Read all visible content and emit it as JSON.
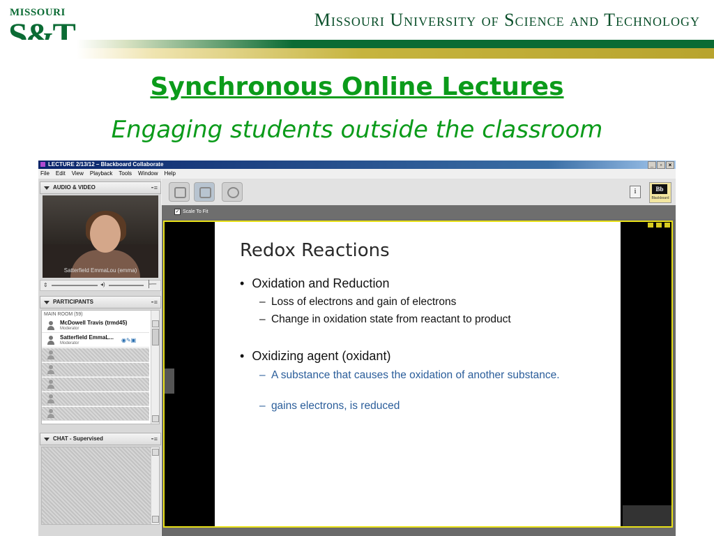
{
  "slide": {
    "logo_top": "MISSOURI",
    "logo_main": "S&T",
    "university": "Missouri University of Science and Technology",
    "title": "Synchronous Online Lectures",
    "subtitle": "Engaging students outside the classroom"
  },
  "colors": {
    "brand_green": "#0b6b34",
    "title_green": "#0b9b1a",
    "gold": "#c6b43e",
    "whiteboard_border": "#e8e018",
    "subpoint_blue": "#2a5d9a"
  },
  "app": {
    "window_title": "LECTURE 2/13/12 – Blackboard Collaborate",
    "window_buttons": [
      "_",
      "▫",
      "×"
    ],
    "menu": [
      "File",
      "Edit",
      "View",
      "Playback",
      "Tools",
      "Window",
      "Help"
    ],
    "audio_video": {
      "header": "AUDIO & VIDEO",
      "video_caption": "Satterfield EmmaLou (emma)"
    },
    "participants": {
      "header": "PARTICIPANTS",
      "room": "MAIN ROOM (59)",
      "people": [
        {
          "name": "McDowell Travis (trmd45)",
          "role": "Moderator"
        },
        {
          "name": "Satterfield EmmaL...",
          "role": "Moderator"
        }
      ]
    },
    "chat": {
      "header": "CHAT - Supervised"
    },
    "toolbar": {
      "info_label": "i",
      "bb_logo": "Bb",
      "bb_logo_sub": "Blackboard"
    },
    "scale_to_fit": "Scale To Fit",
    "scale_checked": "✓"
  },
  "whiteboard": {
    "heading": "Redox Reactions",
    "bullet1": "Oxidation and Reduction",
    "bullet1_subs": [
      "Loss of electrons and gain of electrons",
      "Change in oxidation state from reactant to product"
    ],
    "bullet2": "Oxidizing agent (oxidant)",
    "bullet2_subs": [
      "A substance that causes the oxidation of another substance.",
      "gains electrons, is reduced"
    ],
    "bullet_marker": "•",
    "sub_marker": "–"
  }
}
